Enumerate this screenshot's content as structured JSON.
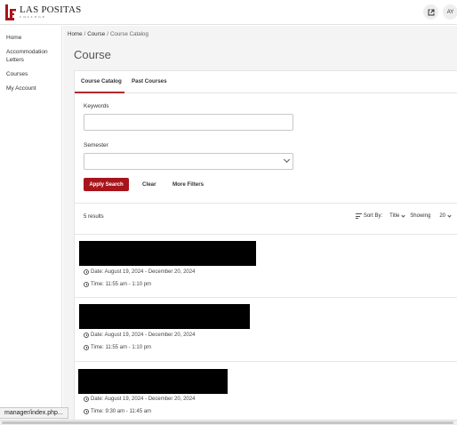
{
  "header": {
    "logo_name": "LAS POSITAS",
    "logo_sub": "COLLEGE",
    "brand_color": "#a8141b",
    "external_link_icon": "external-link-icon",
    "avatar_initials": "AY"
  },
  "sidebar": {
    "items": [
      {
        "label": "Home"
      },
      {
        "label": "Accommodation Letters"
      },
      {
        "label": "Courses"
      },
      {
        "label": "My Account"
      }
    ]
  },
  "breadcrumb": {
    "home": "Home",
    "course": "Course",
    "current": "Course Catalog"
  },
  "page": {
    "title": "Course"
  },
  "tabs": [
    {
      "label": "Course Catalog",
      "active": true
    },
    {
      "label": "Past Courses",
      "active": false
    }
  ],
  "filters": {
    "keywords_label": "Keywords",
    "keywords_value": "",
    "semester_label": "Semester",
    "semester_value": "",
    "apply_label": "Apply Search",
    "clear_label": "Clear",
    "more_label": "More Filters"
  },
  "results": {
    "count_text": "5 results",
    "sort_by_label": "Sort By:",
    "sort_value": "Title",
    "showing_label": "Showing",
    "showing_value": "20",
    "items": [
      {
        "date": "Date: August 19, 2024 - December 20, 2024",
        "time": "Time: 11:55 am - 1:10 pm"
      },
      {
        "date": "Date: August 19, 2024 - December 20, 2024",
        "time": "Time: 11:55 am - 1:10 pm"
      },
      {
        "date": "Date: August 19, 2024 - December 20, 2024",
        "time": "Time: 9:30 am - 11:45 am"
      }
    ]
  },
  "status_bar": {
    "url": "manager/index.php..."
  }
}
